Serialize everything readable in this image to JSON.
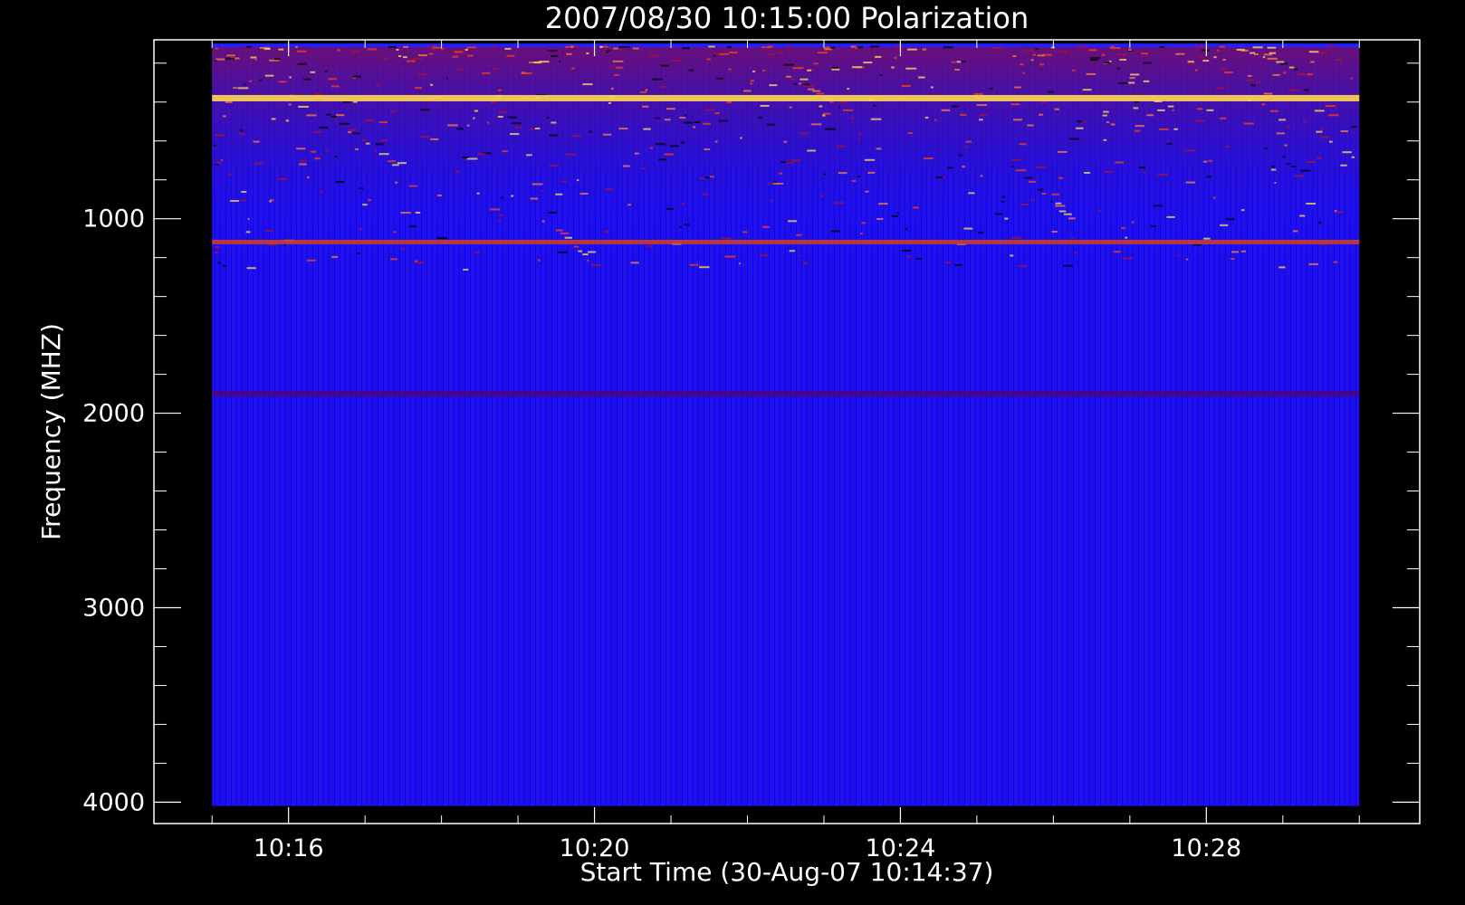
{
  "chart_data": {
    "type": "heatmap",
    "title": "2007/08/30 10:15:00 Polarization",
    "xlabel": "Start Time (30-Aug-07 10:14:37)",
    "ylabel": "Frequency (MHZ)",
    "x_ticks": [
      "10:16",
      "10:20",
      "10:24",
      "10:28"
    ],
    "y_ticks": [
      "1000",
      "2000",
      "3000",
      "4000"
    ],
    "x_tick_minutes": [
      16,
      20,
      24,
      28
    ],
    "y_tick_values": [
      1000,
      2000,
      3000,
      4000
    ],
    "xlim_minutes": [
      14.24,
      30.79
    ],
    "ylim": [
      4110,
      80
    ],
    "data_x_range_minutes": [
      15.0,
      30.0
    ],
    "data_y_range": [
      100,
      4020
    ],
    "grid": false,
    "colormap": [
      "#000000",
      "#0000ff",
      "#b01030",
      "#ff4010",
      "#ffe060",
      "#ffffff"
    ],
    "features": [
      {
        "name": "band",
        "frequency": 380,
        "intensity": "high"
      },
      {
        "name": "band",
        "frequency": 1120,
        "intensity": "high"
      },
      {
        "name": "band",
        "frequency": 1900,
        "intensity": "low"
      }
    ]
  },
  "colors": {
    "background": "#000000",
    "axis": "#ffffff",
    "field": "#1a0ff0"
  }
}
